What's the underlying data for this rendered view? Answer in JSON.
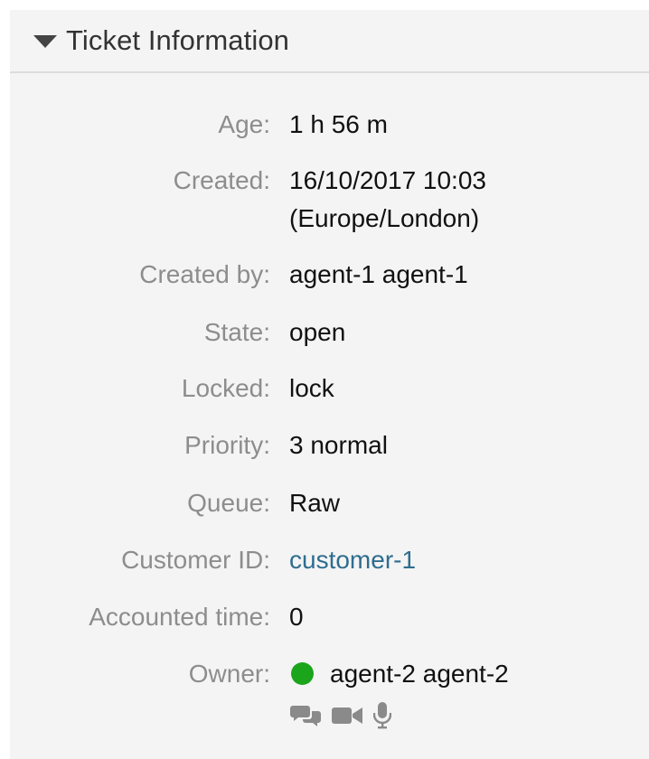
{
  "widget": {
    "title": "Ticket Information"
  },
  "fields": {
    "age": {
      "label": "Age:",
      "value": "1 h 56 m"
    },
    "created": {
      "label": "Created:",
      "value_line1": "16/10/2017 10:03",
      "value_line2": "(Europe/London)"
    },
    "created_by": {
      "label": "Created by:",
      "value": "agent-1 agent-1"
    },
    "state": {
      "label": "State:",
      "value": "open"
    },
    "locked": {
      "label": "Locked:",
      "value": "lock"
    },
    "priority": {
      "label": "Priority:",
      "value": "3 normal"
    },
    "queue": {
      "label": "Queue:",
      "value": "Raw"
    },
    "customer_id": {
      "label": "Customer ID:",
      "value": "customer-1"
    },
    "accounted_time": {
      "label": "Accounted time:",
      "value": "0"
    },
    "owner": {
      "label": "Owner:",
      "value": "agent-2 agent-2",
      "status": "online",
      "status_color": "#1aa51a",
      "actions": [
        "chat-icon",
        "video-call-icon",
        "microphone-icon"
      ]
    }
  },
  "colors": {
    "panel_bg": "#f4f4f4",
    "label": "#8d8d8d",
    "value": "#111111",
    "link": "#2f6d8f"
  }
}
